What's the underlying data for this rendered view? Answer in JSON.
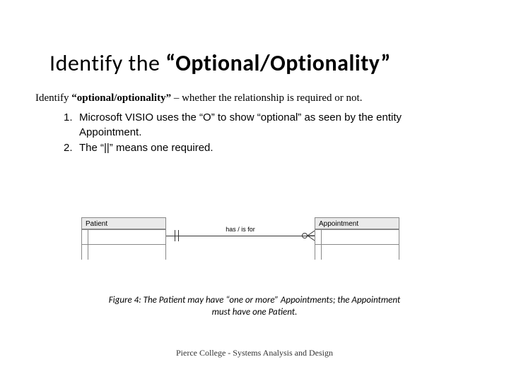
{
  "title_prefix": "Identify the ",
  "title_bold": "“Optional/Optionality”",
  "intro_prefix": "Identify ",
  "intro_bold": "“optional/optionality”",
  "intro_suffix": " – whether the relationship is required or not.",
  "list": [
    {
      "num": "1.",
      "text": " Microsoft VISIO uses the “O” to show “optional” as seen by the entity Appointment."
    },
    {
      "num": "2.",
      "text": " The “||” means one required."
    }
  ],
  "entity_left": "Patient",
  "entity_right": "Appointment",
  "rel_label": "has / is for",
  "caption": "Figure 4: The Patient may have “one or more” Appointments; the Appointment must have one Patient.",
  "footer": "Pierce College - Systems Analysis and Design"
}
